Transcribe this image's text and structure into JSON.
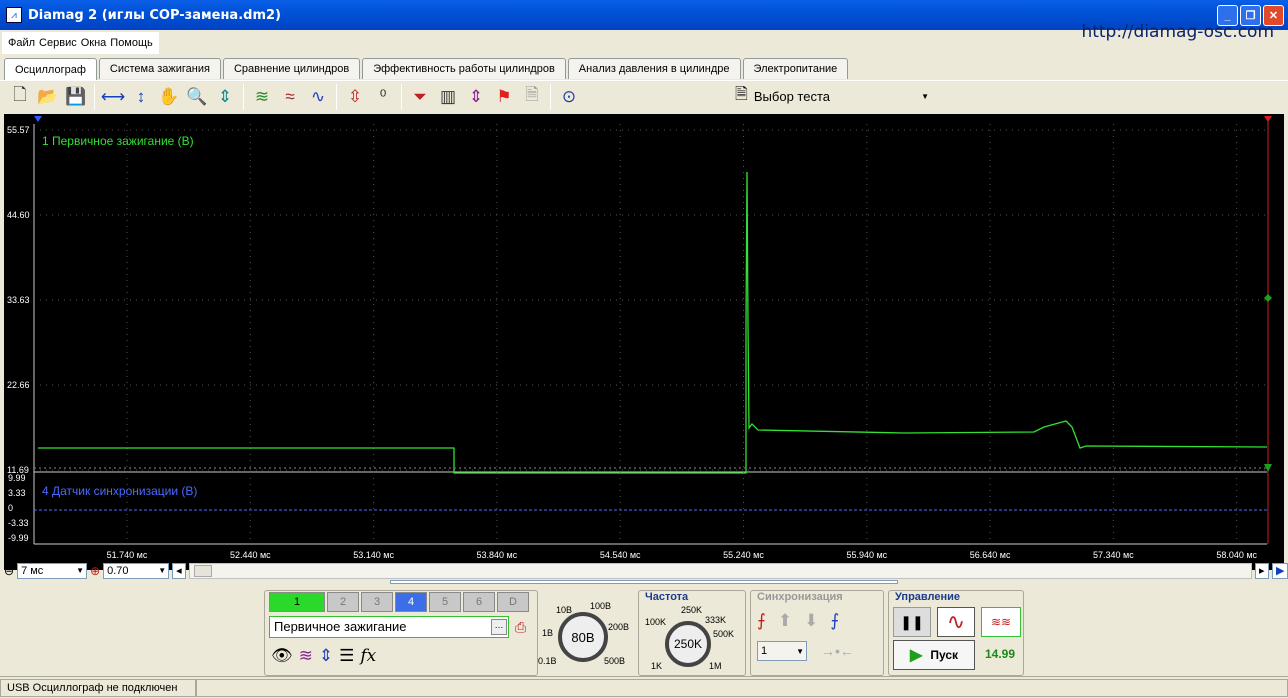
{
  "window": {
    "title": "Diamag 2 (иглы COP-замена.dm2)"
  },
  "menu": {
    "items": [
      "Файл",
      "Сервис",
      "Окна",
      "Помощь"
    ]
  },
  "url_label": "http://diamag-osc.com",
  "tabs": [
    "Осциллограф",
    "Система зажигания",
    "Сравнение цилиндров",
    "Эффективность работы цилиндров",
    "Анализ давления в цилиндре",
    "Электропитание"
  ],
  "toolbar": {
    "test_select": "Выбор теста"
  },
  "scope": {
    "channel1_label": "1 Первичное зажигание (В)",
    "channel4_label": "4 Датчик синхронизации (В)",
    "ch1_yticks": [
      "55.57",
      "44.60",
      "33.63",
      "22.66",
      "11.69"
    ],
    "ch4_yticks": [
      "9.99",
      "3.33",
      "0",
      "-3.33",
      "-9.99"
    ],
    "xticks": [
      "51.740 мс",
      "52.440 мс",
      "53.140 мс",
      "53.840 мс",
      "54.540 мс",
      "55.240 мс",
      "55.940 мс",
      "56.640 мс",
      "57.340 мс",
      "58.040 мс"
    ],
    "trace_color": "#33e033",
    "ch4_color": "#4a6bff"
  },
  "zoom": {
    "time": "7 мс",
    "amp": "0.70"
  },
  "channels": {
    "buttons": [
      "1",
      "2",
      "3",
      "4",
      "5",
      "6",
      "D"
    ],
    "selected_name": "Первичное зажигание"
  },
  "amplitude_knob": {
    "value": "80В",
    "labels": [
      "10В",
      "100В",
      "1В",
      "200В",
      "0.1В",
      "500В"
    ]
  },
  "frequency": {
    "title": "Частота",
    "value": "250K",
    "labels": [
      "250K",
      "100K",
      "333K",
      "500K",
      "1K",
      "1M"
    ]
  },
  "sync": {
    "title": "Синхронизация",
    "value": "1"
  },
  "control": {
    "title": "Управление",
    "start_label": "Пуск",
    "fps": "14.99"
  },
  "status": {
    "text": "USB Осциллограф не подключен"
  }
}
